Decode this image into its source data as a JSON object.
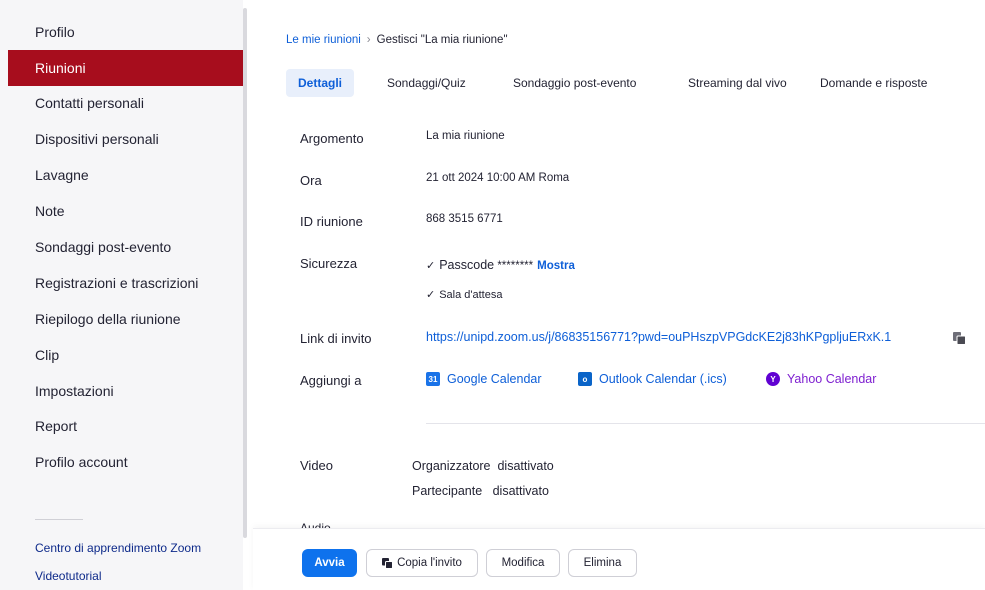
{
  "sidebar": {
    "items": [
      {
        "label": "Profilo"
      },
      {
        "label": "Riunioni",
        "active": true
      },
      {
        "label": "Contatti personali"
      },
      {
        "label": "Dispositivi personali"
      },
      {
        "label": "Lavagne"
      },
      {
        "label": "Note"
      },
      {
        "label": "Sondaggi post-evento"
      },
      {
        "label": "Registrazioni e trascrizioni"
      },
      {
        "label": "Riepilogo della riunione"
      },
      {
        "label": "Clip"
      },
      {
        "label": "Impostazioni"
      },
      {
        "label": "Report"
      },
      {
        "label": "Profilo account"
      }
    ],
    "footer_links": [
      "Centro di apprendimento Zoom",
      "Videotutorial"
    ]
  },
  "breadcrumb": {
    "parent": "Le mie riunioni",
    "separator": "›",
    "current": "Gestisci \"La mia riunione\""
  },
  "tabs": [
    {
      "label": "Dettagli",
      "active": true
    },
    {
      "label": "Sondaggi/Quiz"
    },
    {
      "label": "Sondaggio post-evento"
    },
    {
      "label": "Streaming dal vivo"
    },
    {
      "label": "Domande e risposte"
    }
  ],
  "details": {
    "topic_label": "Argomento",
    "topic_value": "La mia riunione",
    "time_label": "Ora",
    "time_value": "21 ott 2024 10:00 AM Roma",
    "id_label": "ID riunione",
    "id_value": "868 3515 6771",
    "security_label": "Sicurezza",
    "passcode_label": "Passcode",
    "passcode_masked": "********",
    "show_label": "Mostra",
    "waiting_room": "Sala d'attesa",
    "invite_label": "Link di invito",
    "invite_url": "https://unipd.zoom.us/j/86835156771?pwd=ouPHszpVPGdcKE2j83hKPgpljuERxK.1",
    "add_to_label": "Aggiungi a",
    "calendars": [
      {
        "label": "Google Calendar",
        "icon": "google-calendar-icon",
        "color": "#0e5fd8"
      },
      {
        "label": "Outlook Calendar (.ics)",
        "icon": "outlook-icon",
        "color": "#0e5fd8"
      },
      {
        "label": "Yahoo Calendar",
        "icon": "yahoo-icon",
        "color": "#7e1fd0"
      }
    ],
    "video_label": "Video",
    "host_label": "Organizzatore",
    "host_value": "disattivato",
    "participant_label": "Partecipante",
    "participant_value": "disattivato",
    "audio_label": "Audio"
  },
  "actions": {
    "start": "Avvia",
    "copy_invite": "Copia l'invito",
    "edit": "Modifica",
    "delete": "Elimina"
  },
  "colors": {
    "accent": "#0e72ed",
    "active_nav": "#a70d1d",
    "link": "#0e5fd8"
  }
}
